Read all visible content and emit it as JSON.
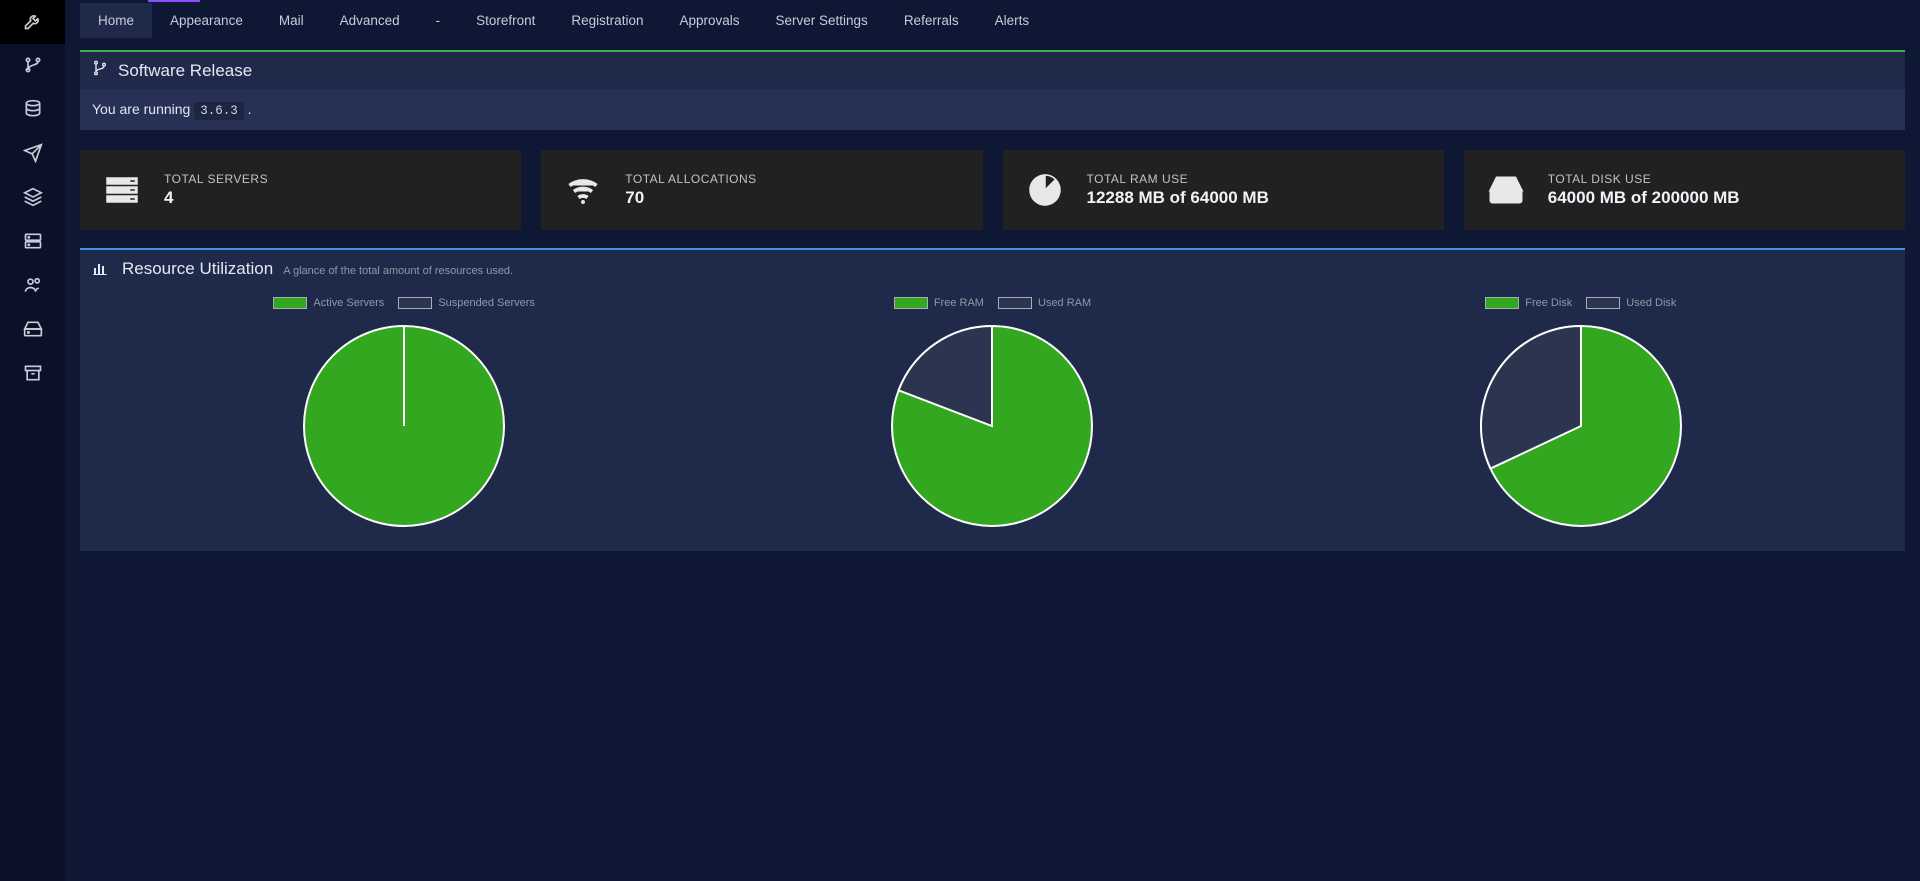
{
  "sidebar": {
    "items": [
      {
        "name": "settings",
        "active": true
      },
      {
        "name": "branches",
        "active": false
      },
      {
        "name": "database",
        "active": false
      },
      {
        "name": "send",
        "active": false
      },
      {
        "name": "layers",
        "active": false
      },
      {
        "name": "servers",
        "active": false
      },
      {
        "name": "users",
        "active": false
      },
      {
        "name": "storage",
        "active": false
      },
      {
        "name": "archive",
        "active": false
      }
    ]
  },
  "tabs": [
    {
      "label": "Home",
      "active": true
    },
    {
      "label": "Appearance",
      "active": false
    },
    {
      "label": "Mail",
      "active": false
    },
    {
      "label": "Advanced",
      "active": false
    },
    {
      "label": "-",
      "active": false
    },
    {
      "label": "Storefront",
      "active": false
    },
    {
      "label": "Registration",
      "active": false
    },
    {
      "label": "Approvals",
      "active": false
    },
    {
      "label": "Server Settings",
      "active": false
    },
    {
      "label": "Referrals",
      "active": false
    },
    {
      "label": "Alerts",
      "active": false
    }
  ],
  "release": {
    "panel_title": "Software Release",
    "running_prefix": "You are running",
    "version": "3.6.3",
    "running_suffix": "."
  },
  "stats": [
    {
      "icon": "server-rack",
      "label": "TOTAL SERVERS",
      "value": "4"
    },
    {
      "icon": "wifi",
      "label": "TOTAL ALLOCATIONS",
      "value": "70"
    },
    {
      "icon": "pie",
      "label": "TOTAL RAM USE",
      "value": "12288 MB of 64000 MB"
    },
    {
      "icon": "disk",
      "label": "TOTAL DISK USE",
      "value": "64000 MB of 200000 MB"
    }
  ],
  "resources": {
    "title": "Resource Utilization",
    "subtitle": "A glance of the total amount of resources used."
  },
  "chart_data": [
    {
      "type": "pie",
      "title": "Servers",
      "series": [
        {
          "name": "Active Servers",
          "value": 4,
          "color": "#33a720"
        },
        {
          "name": "Suspended Servers",
          "value": 0,
          "color": "#2b3550"
        }
      ]
    },
    {
      "type": "pie",
      "title": "RAM",
      "series": [
        {
          "name": "Free RAM",
          "value": 51712,
          "color": "#33a720"
        },
        {
          "name": "Used RAM",
          "value": 12288,
          "color": "#2b3550"
        }
      ]
    },
    {
      "type": "pie",
      "title": "Disk",
      "series": [
        {
          "name": "Free Disk",
          "value": 136000,
          "color": "#33a720"
        },
        {
          "name": "Used Disk",
          "value": 64000,
          "color": "#2b3550"
        }
      ]
    }
  ],
  "colors": {
    "accent_green": "#33b249",
    "accent_blue": "#4a90e2",
    "pie_green": "#33a720",
    "pie_dark": "#2b3550",
    "pie_stroke": "#ffffff"
  }
}
